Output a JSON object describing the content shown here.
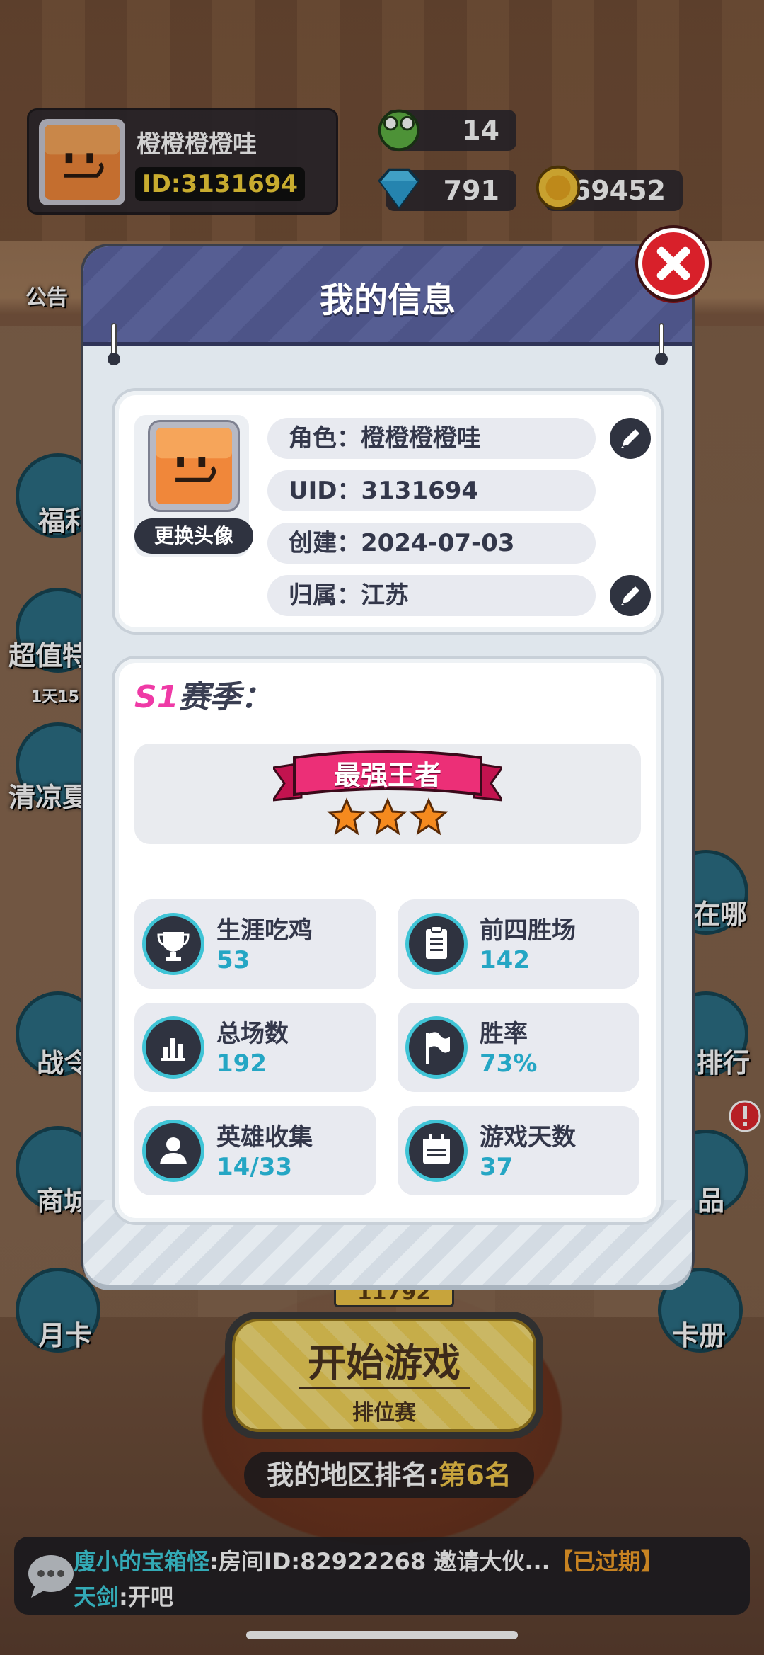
{
  "hud": {
    "player_name": "橙橙橙橙哇",
    "player_id": "ID:3131694",
    "resources": {
      "tickets": "14",
      "diamonds": "791",
      "coins": "69452"
    }
  },
  "side_menu": {
    "left": [
      "公告",
      "福利",
      "超值特",
      "1天15",
      "清凉夏",
      "战令",
      "商城",
      "月卡"
    ],
    "right": [
      "在哪",
      "排行",
      "品",
      "卡册"
    ]
  },
  "modal": {
    "title": "我的信息",
    "profile": {
      "change_avatar_label": "更换头像",
      "role": "角色：橙橙橙橙哇",
      "uid": "UID：3131694",
      "created": "创建：2024-07-03",
      "region": "归属：江苏"
    },
    "season": {
      "season_code": "S1",
      "season_suffix": "赛季：",
      "rank_name": "最强王者",
      "rank_stars": 3,
      "stats": [
        {
          "label": "生涯吃鸡",
          "value": "53",
          "icon": "trophy-icon"
        },
        {
          "label": "前四胜场",
          "value": "142",
          "icon": "clipboard-icon"
        },
        {
          "label": "总场数",
          "value": "192",
          "icon": "bar-chart-icon"
        },
        {
          "label": "胜率",
          "value": "73%",
          "icon": "flag-icon"
        },
        {
          "label": "英雄收集",
          "value": "14/33",
          "icon": "user-icon"
        },
        {
          "label": "游戏天数",
          "value": "37",
          "icon": "calendar-icon"
        }
      ]
    }
  },
  "game": {
    "score_chip": "11792",
    "start_title": "开始游戏",
    "start_subtitle": "排位赛",
    "rank_label": "我的地区排名:",
    "rank_value": "第6名"
  },
  "chat": {
    "line1_who": "廋小的宝箱怪",
    "line1_msg": ":房间ID:82922268 邀请大伙...",
    "line1_tag": "【已过期】",
    "line2_who": "天剑",
    "line2_msg": ":开吧"
  },
  "colors": {
    "accent_cyan": "#3fc4d6",
    "value_blue": "#25a6c4",
    "season_pink": "#ef3aa6",
    "close_red": "#d8202a",
    "header_purple": "#4d5488"
  }
}
